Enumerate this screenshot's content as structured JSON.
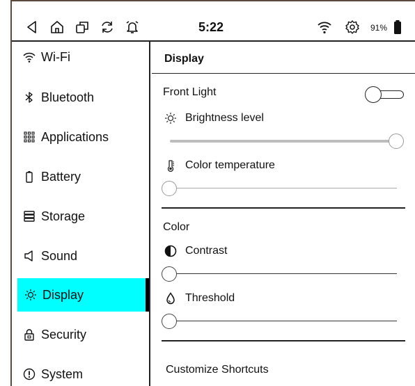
{
  "status_bar": {
    "time": "5:22",
    "battery_percent": "91%",
    "icons": [
      "back-icon",
      "home-icon",
      "recent-apps-icon",
      "refresh-icon",
      "alarm-icon",
      "wifi-icon",
      "settings-icon",
      "battery-icon"
    ]
  },
  "sidebar": {
    "items": [
      {
        "label": "Wi-Fi",
        "icon": "wifi-icon"
      },
      {
        "label": "Bluetooth",
        "icon": "bluetooth-icon"
      },
      {
        "label": "Applications",
        "icon": "apps-grid-icon"
      },
      {
        "label": "Battery",
        "icon": "battery-icon"
      },
      {
        "label": "Storage",
        "icon": "storage-icon"
      },
      {
        "label": "Sound",
        "icon": "speaker-icon"
      },
      {
        "label": "Display",
        "icon": "sun-icon",
        "active": true
      },
      {
        "label": "Security",
        "icon": "lock-icon"
      },
      {
        "label": "System",
        "icon": "info-icon"
      }
    ],
    "active_color": "#00ffff"
  },
  "panel": {
    "title": "Display",
    "front_light": {
      "label": "Front Light",
      "toggle_on": false,
      "brightness": {
        "label": "Brightness level",
        "icon": "sun-icon",
        "value": 1.0,
        "enabled": false
      },
      "color_temperature": {
        "label": "Color temperature",
        "icon": "thermometer-icon",
        "value": 0.0,
        "enabled": false
      }
    },
    "color": {
      "label": "Color",
      "contrast": {
        "label": "Contrast",
        "icon": "contrast-icon",
        "value": 0.0
      },
      "threshold": {
        "label": "Threshold",
        "icon": "drop-icon",
        "value": 0.0
      }
    },
    "customize_shortcuts": {
      "label": "Customize Shortcuts"
    }
  }
}
